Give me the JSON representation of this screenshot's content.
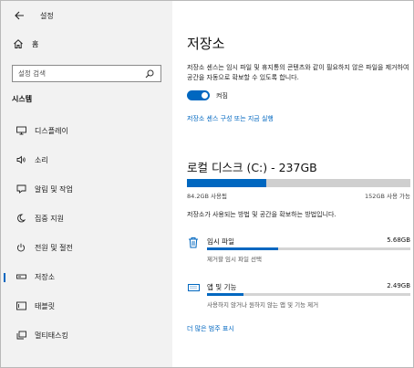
{
  "window": {
    "app_title": "설정"
  },
  "sidebar": {
    "home_label": "홈",
    "search_placeholder": "설정 검색",
    "section_title": "시스템",
    "items": [
      {
        "label": "디스플레이",
        "icon": "monitor-icon"
      },
      {
        "label": "소리",
        "icon": "speaker-icon"
      },
      {
        "label": "알림 및 작업",
        "icon": "notification-icon"
      },
      {
        "label": "집중 지원",
        "icon": "moon-icon"
      },
      {
        "label": "전원 및 절전",
        "icon": "power-icon"
      },
      {
        "label": "저장소",
        "icon": "storage-icon",
        "active": true
      },
      {
        "label": "태블릿",
        "icon": "tablet-icon"
      },
      {
        "label": "멀티태스킹",
        "icon": "multitasking-icon"
      }
    ]
  },
  "main": {
    "title": "저장소",
    "description": "저장소 센스는 임시 파일 및 휴지통의 콘텐츠와 같이 필요하지 않은 파일을 제거하여 공간을 자동으로 확보할 수 있도록 합니다.",
    "toggle": {
      "state": true,
      "label": "켜짐"
    },
    "config_link": "저장소 센스 구성 또는 지금 실행",
    "drive": {
      "title": "로컬 디스크 (C:) - 237GB",
      "used_label": "84.2GB 사용됨",
      "free_label": "152GB 사용 가능",
      "used_fraction": 0.355
    },
    "method_text": "저장소가 사용되는 방법 및 공간을 확보하는 방법입니다.",
    "categories": [
      {
        "icon": "trash-icon",
        "name": "임시 파일",
        "size": "5.68GB",
        "desc": "제거할 임시 파일 선택",
        "fraction": 0.35
      },
      {
        "icon": "keyboard-icon",
        "name": "앱 및 기능",
        "size": "2.49GB",
        "desc": "사용하지 않거나 원하지 않는 앱 및 기능 제거",
        "fraction": 0.18
      }
    ],
    "more_link": "더 많은 범주 표시"
  },
  "colors": {
    "accent": "#0067c0",
    "sidebar_bg": "#f2f2f2"
  }
}
